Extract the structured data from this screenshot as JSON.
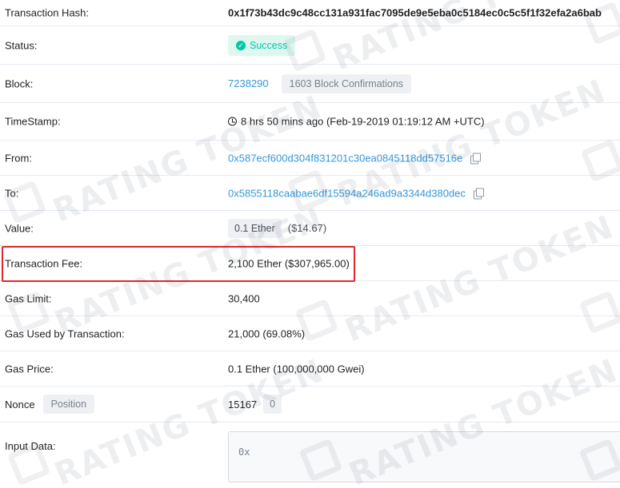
{
  "rows": {
    "hash": {
      "label": "Transaction Hash:",
      "value": "0x1f73b43dc9c48cc131a931fac7095de9e5eba0c5184ec0c5c5f1f32efa2a6bab"
    },
    "status": {
      "label": "Status:",
      "value": "Success"
    },
    "block": {
      "label": "Block:",
      "value": "7238290",
      "confirmations": "1603 Block Confirmations"
    },
    "timestamp": {
      "label": "TimeStamp:",
      "value": "8 hrs 50 mins ago (Feb-19-2019 01:19:12 AM +UTC)"
    },
    "from": {
      "label": "From:",
      "value": "0x587ecf600d304f831201c30ea0845118dd57516e"
    },
    "to": {
      "label": "To:",
      "value": "0x5855118caabae6df15594a246ad9a3344d380dec"
    },
    "value": {
      "label": "Value:",
      "amount": "0.1 Ether",
      "usd": "($14.67)"
    },
    "fee": {
      "label": "Transaction Fee:",
      "value": "2,100 Ether ($307,965.00)"
    },
    "gas_limit": {
      "label": "Gas Limit:",
      "value": "30,400"
    },
    "gas_used": {
      "label": "Gas Used by Transaction:",
      "value": "21,000 (69.08%)"
    },
    "gas_price": {
      "label": "Gas Price:",
      "value": "0.1 Ether (100,000,000 Gwei)"
    },
    "nonce": {
      "label": "Nonce",
      "position_label": "Position",
      "value": "15167",
      "position": "0"
    },
    "input": {
      "label": "Input Data:",
      "value": "0x"
    }
  },
  "watermark": {
    "text": "RATING TOKEN"
  },
  "colors": {
    "link": "#3498db",
    "success": "#00c9a7",
    "highlight": "#e4262b"
  }
}
